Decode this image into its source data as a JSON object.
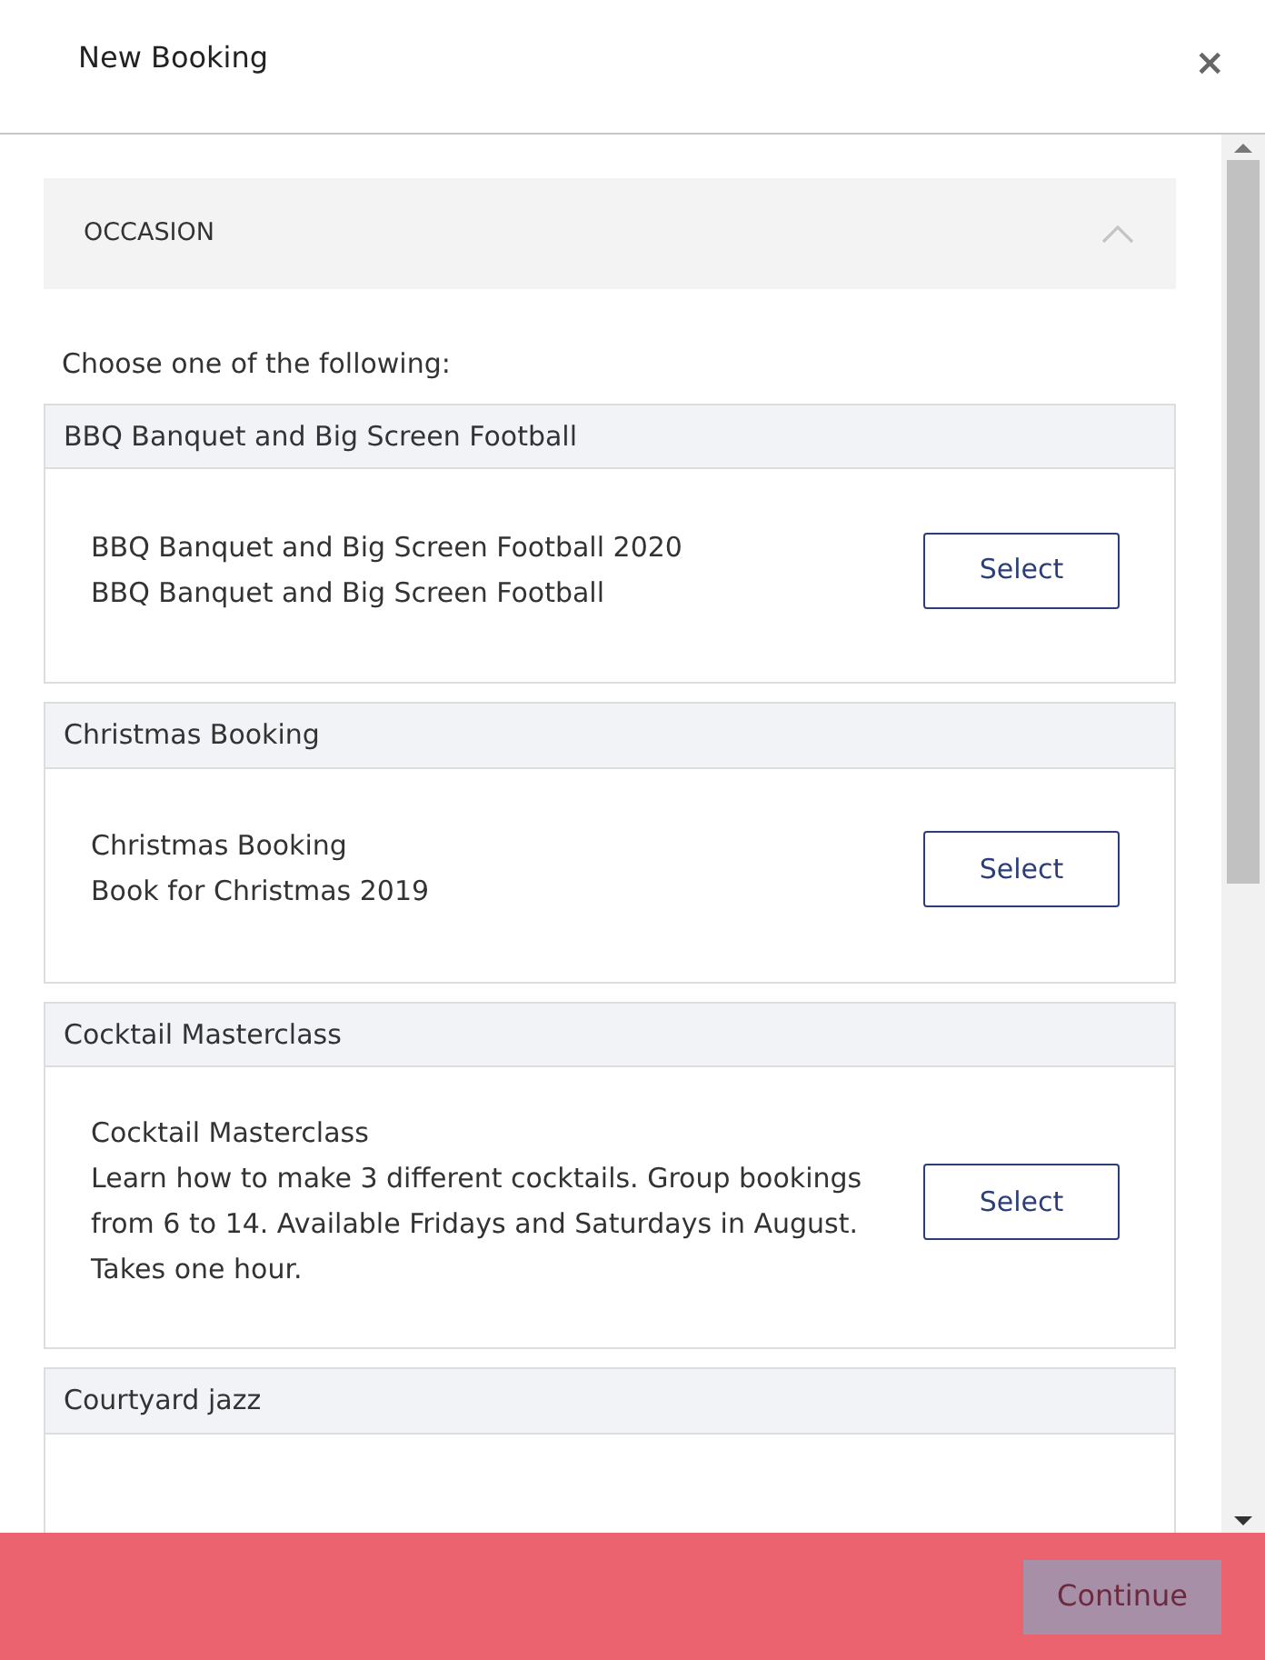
{
  "dialog": {
    "title": "New Booking",
    "close": "×"
  },
  "section": {
    "title": "OCCASION",
    "expanded": true,
    "prompt": "Choose one of the following:"
  },
  "occasions": [
    {
      "title": "BBQ Banquet and Big Screen Football",
      "lines": [
        "BBQ Banquet and Big Screen Football 2020",
        "BBQ Banquet and Big Screen Football"
      ],
      "button": "Select"
    },
    {
      "title": "Christmas Booking",
      "lines": [
        "Christmas Booking",
        "Book for Christmas 2019"
      ],
      "button": "Select"
    },
    {
      "title": "Cocktail Masterclass",
      "lines": [
        "Cocktail Masterclass",
        "Learn how to make 3 different cocktails. Group bookings from 6 to 14. Available Fridays and Saturdays in August. Takes one hour."
      ],
      "button": "Select"
    },
    {
      "title": "Courtyard jazz"
    }
  ],
  "footer": {
    "button": "Continue",
    "disabled": true
  }
}
